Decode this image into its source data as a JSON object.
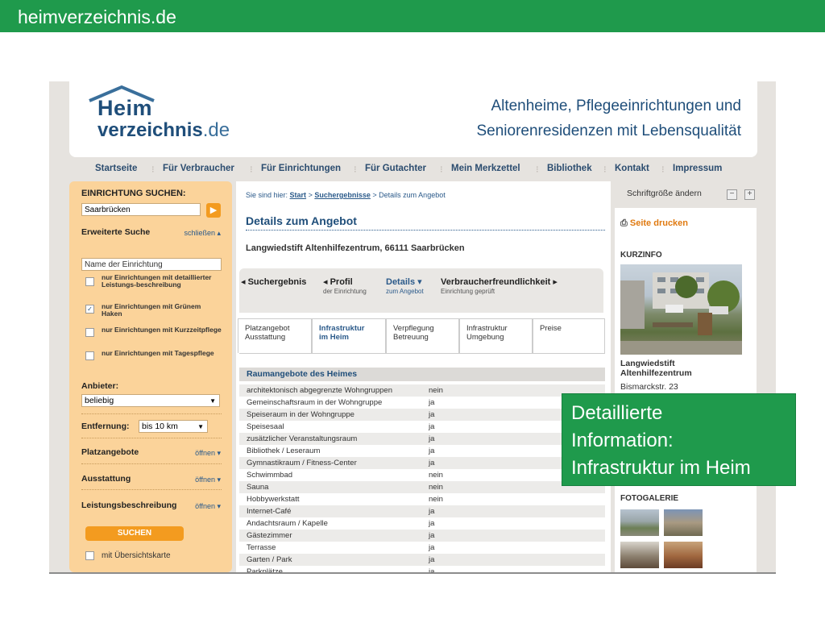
{
  "slide": {
    "title": "heimverzeichnis.de",
    "callout_lines": [
      "Detaillierte",
      "Information:",
      "Infrastruktur im Heim"
    ]
  },
  "header": {
    "logo_line1": "Heim",
    "logo_line2_bold": "verzeichnis",
    "logo_line2_suffix": ".de",
    "slogan_line1": "Altenheime, Pflegeeinrichtungen und",
    "slogan_line2": "Seniorenresidenzen mit Lebensqualität"
  },
  "nav": [
    "Startseite",
    "Für Verbraucher",
    "Für Einrichtungen",
    "Für Gutachter",
    "Mein Merkzettel",
    "Bibliothek",
    "Kontakt",
    "Impressum"
  ],
  "sidebar": {
    "title": "EINRICHTUNG SUCHEN:",
    "search_value": "Saarbrücken",
    "advanced_label": "Erweiterte Suche",
    "advanced_toggle": "schließen ▴",
    "name_placeholder": "Name der Einrichtung",
    "checkboxes": [
      {
        "label": "nur Einrichtungen mit detaillierter Leistungs-beschreibung",
        "checked": false
      },
      {
        "label": "nur Einrichtungen mit Grünem Haken",
        "checked": true
      },
      {
        "label": "nur Einrichtungen mit Kurzzeitpflege",
        "checked": false
      },
      {
        "label": "nur Einrichtungen mit Tagespflege",
        "checked": false
      }
    ],
    "provider_label": "Anbieter:",
    "provider_value": "beliebig",
    "distance_label": "Entfernung:",
    "distance_value": "bis 10 km",
    "sections": [
      {
        "label": "Platzangebote",
        "toggle": "öffnen ▾"
      },
      {
        "label": "Ausstattung",
        "toggle": "öffnen ▾"
      },
      {
        "label": "Leistungsbeschreibung",
        "toggle": "öffnen ▾"
      }
    ],
    "submit": "SUCHEN",
    "map_label": "mit Übersichtskarte"
  },
  "main": {
    "breadcrumb_prefix": "Sie sind hier:",
    "breadcrumb_start": "Start",
    "breadcrumb_results": "Suchergebnisse",
    "breadcrumb_current": "> Details zum Angebot",
    "title": "Details zum Angebot",
    "facility": "Langwiedstift Altenhilfezentrum, 66111 Saarbrücken",
    "steps": [
      {
        "label": "◂ Suchergebnis",
        "sub": ""
      },
      {
        "label": "◂ Profil",
        "sub": "der Einrichtung"
      },
      {
        "label": "Details ▾",
        "sub": "zum Angebot"
      },
      {
        "label": "Verbraucherfreundlichkeit ▸",
        "sub": "Einrichtung geprüft"
      }
    ],
    "tabs": [
      {
        "line1": "Platzangebot",
        "line2": "Ausstattung"
      },
      {
        "line1": "Infrastruktur",
        "line2": "im Heim"
      },
      {
        "line1": "Verpflegung",
        "line2": "Betreuung"
      },
      {
        "line1": "Infrastruktur",
        "line2": "Umgebung"
      },
      {
        "line1": "Preise",
        "line2": ""
      }
    ],
    "section_title": "Raumangebote des Heimes",
    "rows": [
      {
        "k": "architektonisch abgegrenzte Wohngruppen",
        "v": "nein"
      },
      {
        "k": "Gemeinschaftsraum in der Wohngruppe",
        "v": "ja"
      },
      {
        "k": "Speiseraum in der Wohngruppe",
        "v": "ja"
      },
      {
        "k": "Speisesaal",
        "v": "ja"
      },
      {
        "k": "zusätzlicher Veranstaltungsraum",
        "v": "ja"
      },
      {
        "k": "Bibliothek / Leseraum",
        "v": "ja"
      },
      {
        "k": "Gymnastikraum / Fitness-Center",
        "v": "ja"
      },
      {
        "k": "Schwimmbad",
        "v": "nein"
      },
      {
        "k": "Sauna",
        "v": "nein"
      },
      {
        "k": "Hobbywerkstatt",
        "v": "nein"
      },
      {
        "k": "Internet-Café",
        "v": "ja"
      },
      {
        "k": "Andachtsraum / Kapelle",
        "v": "ja"
      },
      {
        "k": "Gästezimmer",
        "v": "ja"
      },
      {
        "k": "Terrasse",
        "v": "ja"
      },
      {
        "k": "Garten / Park",
        "v": "ja"
      },
      {
        "k": "Parkplätze",
        "v": "ja"
      }
    ]
  },
  "right": {
    "font_size_label": "Schriftgröße ändern",
    "font_minus": "−",
    "font_plus": "+",
    "print": "Seite drucken",
    "kurzinfo": "KURZINFO",
    "house_name_1": "Langwiedstift",
    "house_name_2": "Altenhilfezentrum",
    "house_address": "Bismarckstr. 23",
    "gallery": "FOTOGALERIE"
  }
}
